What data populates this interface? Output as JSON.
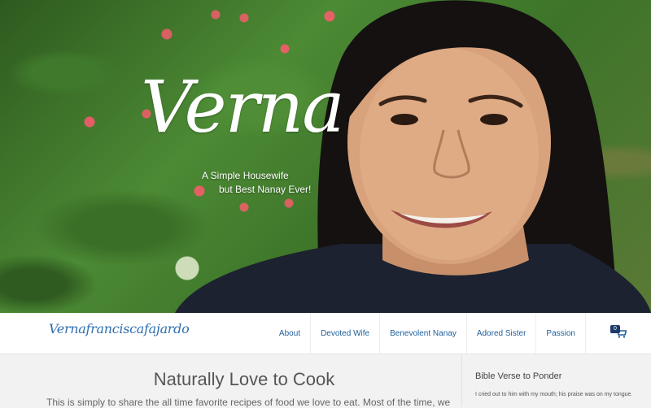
{
  "hero": {
    "logo_text": "Verna",
    "tagline_line1": "A Simple Housewife",
    "tagline_line2": "but Best Nanay Ever!"
  },
  "header": {
    "brand": "Vernafranciscafajardo"
  },
  "nav": {
    "items": [
      {
        "label": "About"
      },
      {
        "label": "Devoted Wife"
      },
      {
        "label": "Benevolent Nanay"
      },
      {
        "label": "Adored Sister"
      },
      {
        "label": "Passion"
      }
    ],
    "cart_icon": "shopping-cart-icon",
    "cart_count": "0"
  },
  "main": {
    "title": "Naturally Love to Cook",
    "intro": "This is simply to share the all time favorite recipes of food we love to eat. Most of the time, we"
  },
  "sidebar": {
    "title": "Bible Verse to Ponder",
    "text": "I cried out to him with my mouth; his praise was on my tongue."
  },
  "colors": {
    "link": "#1e5f9c",
    "badge": "#1d3a6b"
  }
}
